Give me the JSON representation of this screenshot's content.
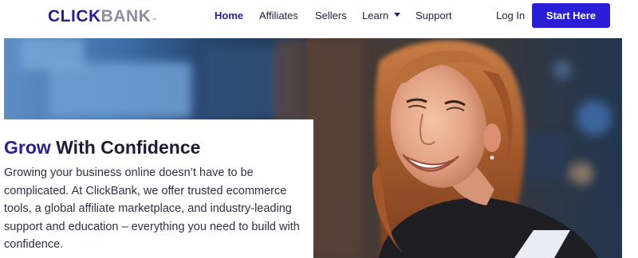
{
  "brand": {
    "logo_part1": "CLICK",
    "logo_part2": "BANK",
    "logo_mark": "™"
  },
  "nav": {
    "items": [
      {
        "label": "Home",
        "active": true
      },
      {
        "label": "Affiliates",
        "active": false
      },
      {
        "label": "Sellers",
        "active": false
      },
      {
        "label": "Learn",
        "active": false,
        "dropdown": true
      },
      {
        "label": "Support",
        "active": false
      }
    ],
    "login_label": "Log In",
    "cta_label": "Start Here"
  },
  "hero": {
    "headline_strong": "Grow",
    "headline_rest": " With Confidence",
    "body": "Growing your business online doesn’t have to be complicated. At ClickBank, we offer trusted ecommerce tools, a global affiliate marketplace, and industry-leading support and education – everything you need to build with confidence.",
    "image_subject": "smiling-woman-photo"
  },
  "colors": {
    "brand_primary": "#2a1f8f",
    "cta_background": "#2a1fd6",
    "logo_secondary": "#8a8fa3",
    "text_dark": "#1c1d33"
  }
}
